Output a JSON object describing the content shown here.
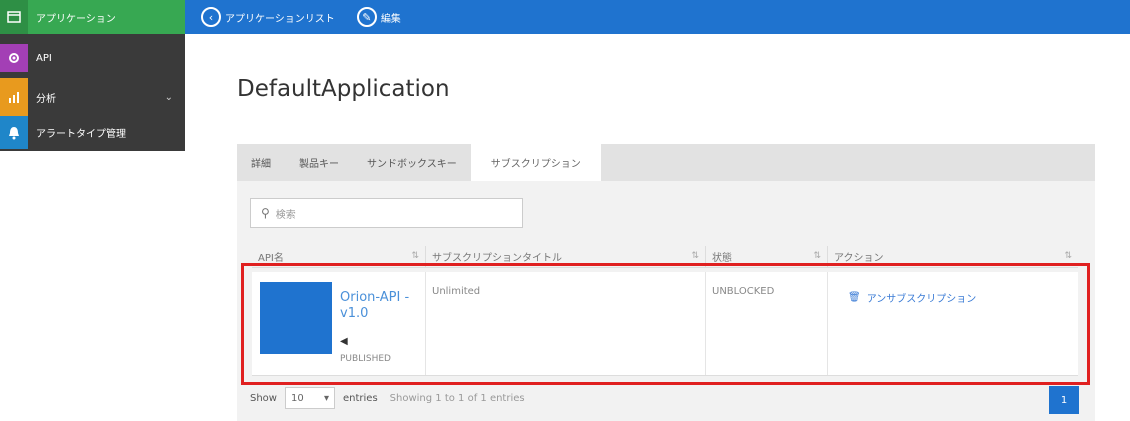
{
  "sidebar": {
    "items": [
      {
        "label": "アプリケーション",
        "icon": "window-icon"
      },
      {
        "label": "API",
        "icon": "gear-icon"
      },
      {
        "label": "分析",
        "icon": "chart-icon"
      },
      {
        "label": "アラートタイプ管理",
        "icon": "bell-icon"
      }
    ]
  },
  "topbar": {
    "app_list_label": "アプリケーションリスト",
    "edit_label": "編集"
  },
  "page": {
    "title": "DefaultApplication"
  },
  "tabs": [
    {
      "label": "詳細"
    },
    {
      "label": "製品キー"
    },
    {
      "label": "サンドボックスキー"
    },
    {
      "label": "サブスクリプション",
      "active": true
    }
  ],
  "search": {
    "placeholder": "検索"
  },
  "table": {
    "headers": [
      "API名",
      "サブスクリプションタイトル",
      "状態",
      "アクション"
    ],
    "rows": [
      {
        "api_name": "Orion-API - v1.0",
        "api_status": "PUBLISHED",
        "subscription_tier": "Unlimited",
        "state": "UNBLOCKED",
        "action": "アンサブスクリプション"
      }
    ]
  },
  "footer": {
    "show_label": "Show",
    "page_size": "10",
    "entries_label": "entries",
    "info": "Showing 1 to 1 of 1 entries",
    "current_page": "1"
  },
  "colors": {
    "accent": "#1f73cf",
    "sidebar_active": "#37a852",
    "highlight": "#e02020"
  }
}
